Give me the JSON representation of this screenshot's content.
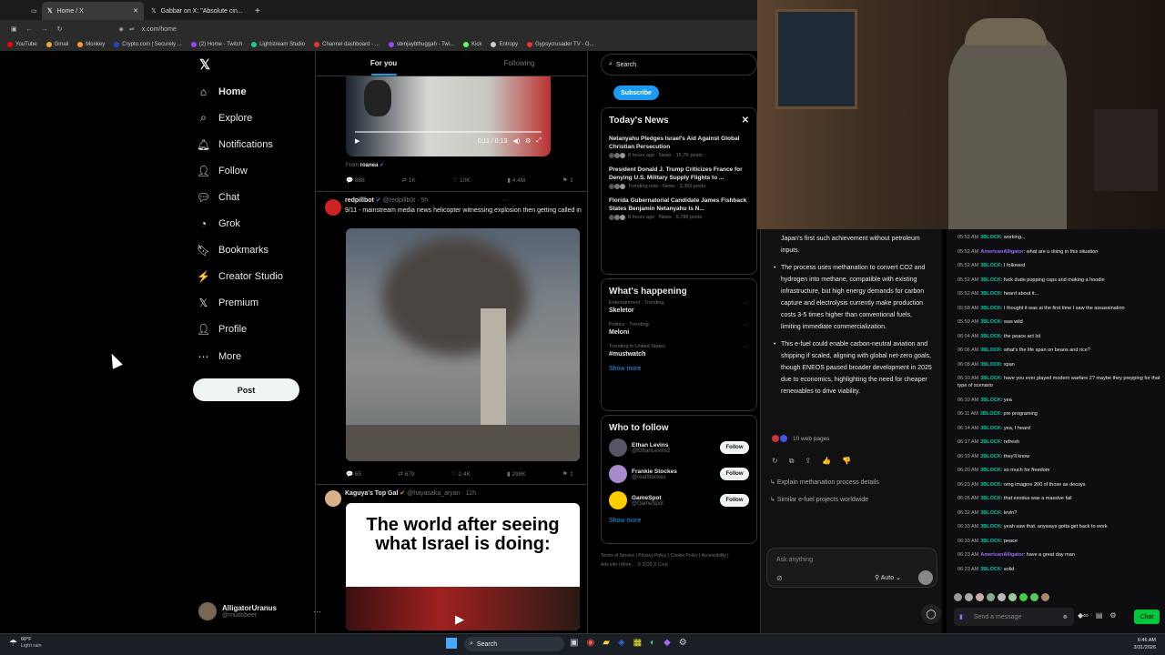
{
  "browser": {
    "tabs": [
      {
        "label": "Home / X"
      },
      {
        "label": "Gabbar on X: \"Absolute cin..."
      }
    ],
    "url": "x.com/home",
    "bookmarks": [
      "YouTube",
      "Gmail",
      "Monkey",
      "Crypto.com | Securely ...",
      "(2) Home - Twitch",
      "Lightstream Studio",
      "Channel dashboard - ...",
      "sbmjaybthuggah - Twi...",
      "Kick",
      "Entropy",
      "Gypsycrusader TV - G..."
    ]
  },
  "nav": {
    "items": [
      "Home",
      "Explore",
      "Notifications",
      "Follow",
      "Chat",
      "Grok",
      "Bookmarks",
      "Creator Studio",
      "Premium",
      "Profile",
      "More"
    ],
    "post": "Post",
    "account": {
      "name": "AlligatorUranus",
      "handle": "@mudsbeer"
    }
  },
  "feed": {
    "tabs": [
      "For you",
      "Following"
    ],
    "video1": {
      "time": "0:11 / 0:13",
      "from": "From",
      "from_user": "roanea",
      "stats": [
        "888",
        "1K",
        "10K",
        "4.4M"
      ]
    },
    "post2": {
      "name": "redpillbot",
      "meta": "@redpillb0t · 5h",
      "text": "9/11 - mainstream media news helicopter witnessing explosion then getting called in",
      "stats": [
        "65",
        "679",
        "2.4K",
        "298K"
      ]
    },
    "post3": {
      "name": "Kaguya's Top Gal",
      "meta": "@hayasaka_aryan · 11h",
      "caption": "The world after seeing what Israel is doing:"
    }
  },
  "right": {
    "search_placeholder": "Search",
    "subscribe": "Subscribe",
    "news_title": "Today's News",
    "news": [
      {
        "headline": "Netanyahu Pledges Israel's Aid Against Global Christian Persecution",
        "meta": "8 hours ago · News · 15.7K posts"
      },
      {
        "headline": "President Donald J. Trump Criticizes France for Denying U.S. Military Supply Flights to ...",
        "meta": "Trending now · News · 3,356 posts"
      },
      {
        "headline": "Florida Gubernatorial Candidate James Fishback States Benjamin Netanyahu Is N...",
        "meta": "8 hours ago · News · 9,788 posts"
      }
    ],
    "happening_title": "What's happening",
    "trends": [
      {
        "context": "Entertainment · Trending",
        "name": "Skeletor"
      },
      {
        "context": "Politics · Trending",
        "name": "Meloni"
      },
      {
        "context": "Trending in United States",
        "name": "#mustwatch"
      }
    ],
    "show_more": "Show more",
    "follow_title": "Who to follow",
    "follow": [
      {
        "name": "Ethan Levins",
        "handle": "@EthanLevins2",
        "btn": "Follow"
      },
      {
        "name": "Frankie Stockes",
        "handle": "@realStockes",
        "btn": "Follow"
      },
      {
        "name": "GameSpot",
        "handle": "@GameSpot",
        "btn": "Follow"
      }
    ],
    "footer": "Terms of Service | Privacy Policy | Cookie Policy | Accessibility | Ads info | More ... © 2026 X Corp."
  },
  "grok": {
    "intro": "Japan's first such achievement without petroleum inputs.",
    "bullets": [
      "The process uses methanation to convert CO2 and hydrogen into methane, compatible with existing infrastructure, but high energy demands for carbon capture and electrolysis currently make production costs 3-5 times higher than conventional fuels, limiting immediate commercialization.",
      "This e-fuel could enable carbon-neutral aviation and shipping if scaled, aligning with global net-zero goals, though ENEOS paused broader development in 2025 due to economics, highlighting the need for cheaper renewables to drive viability."
    ],
    "sources": "10 web pages",
    "suggestions": [
      "Explain methanation process details",
      "Similar e-fuel projects worldwide"
    ],
    "input_placeholder": "Ask anything",
    "mode": "Auto"
  },
  "chat": {
    "messages": [
      {
        "time": "05:52 AM",
        "user": "3BLOCK",
        "text": ": working...",
        "alt": false
      },
      {
        "time": "05:52 AM",
        "user": "AmericanAlligator",
        "text": ": what are u doing in this situation",
        "alt": true
      },
      {
        "time": "05:52 AM",
        "user": "3BLOCK",
        "text": ": I followed",
        "alt": false
      },
      {
        "time": "05:52 AM",
        "user": "3BLOCK",
        "text": ": fuck dude popping caps and making a hoodie",
        "alt": false
      },
      {
        "time": "05:52 AM",
        "user": "3BLOCK",
        "text": ": heard about it...",
        "alt": false
      },
      {
        "time": "05:58 AM",
        "user": "3BLOCK",
        "text": ": I thought it was ai the first time I saw the assassination",
        "alt": false
      },
      {
        "time": "05:59 AM",
        "user": "3BLOCK",
        "text": ": was wild",
        "alt": false
      },
      {
        "time": "06:04 AM",
        "user": "3BLOCK",
        "text": ": the peace act lol",
        "alt": false
      },
      {
        "time": "06:06 AM",
        "user": "3BLOCK",
        "text": ": what's the life span on beans and rice?",
        "alt": false
      },
      {
        "time": "06:08 AM",
        "user": "3BLOCK",
        "text": ": span",
        "alt": false
      },
      {
        "time": "06:10 AM",
        "user": "3BLOCK",
        "text": ": have you ever played modern warfare 2? maybe they prepping for that type of scenario",
        "alt": false
      },
      {
        "time": "06:10 AM",
        "user": "3BLOCK",
        "text": ": yea",
        "alt": false
      },
      {
        "time": "06:11 AM",
        "user": "3BLOCK",
        "text": ": pre programing",
        "alt": false
      },
      {
        "time": "06:14 AM",
        "user": "3BLOCK",
        "text": ": yea, I heard",
        "alt": false
      },
      {
        "time": "06:17 AM",
        "user": "3BLOCK",
        "text": ": refresh",
        "alt": false
      },
      {
        "time": "06:19 AM",
        "user": "3BLOCK",
        "text": ": they'll know",
        "alt": false
      },
      {
        "time": "06:20 AM",
        "user": "3BLOCK",
        "text": ": so much for freedom",
        "alt": false
      },
      {
        "time": "06:23 AM",
        "user": "3BLOCK",
        "text": ": omg imagine 200 of those as decoys",
        "alt": false
      },
      {
        "time": "06:26 AM",
        "user": "3BLOCK",
        "text": ": that exodus was a massive fail",
        "alt": false
      },
      {
        "time": "06:32 AM",
        "user": "3BLOCK",
        "text": ": levin?",
        "alt": false
      },
      {
        "time": "06:33 AM",
        "user": "3BLOCK",
        "text": ": yeah saw that. anyways gotta get back to work",
        "alt": false
      },
      {
        "time": "06:33 AM",
        "user": "3BLOCK",
        "text": ": peace",
        "alt": false
      },
      {
        "time": "06:33 AM",
        "user": "AmericanAlligator",
        "text": ": have a great day man",
        "alt": true
      },
      {
        "time": "06:33 AM",
        "user": "3BLOCK",
        "text": ": solid",
        "alt": false
      }
    ],
    "input_placeholder": "Send a message",
    "send": "Chat"
  },
  "taskbar": {
    "weather_temp": "60°F",
    "weather_desc": "Light rain",
    "search": "Search",
    "time": "6:46 AM",
    "date": "3/31/2026"
  }
}
